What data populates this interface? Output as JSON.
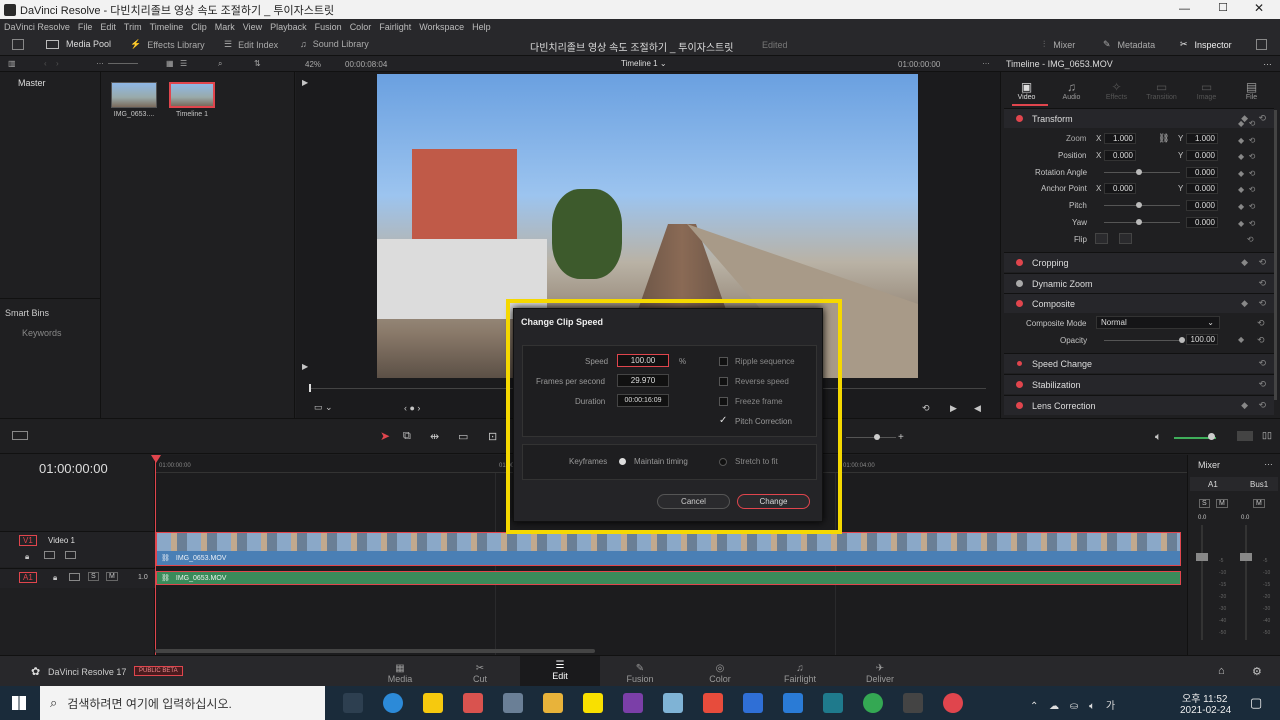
{
  "window": {
    "title": "DaVinci Resolve - 다빈치리졸브 영상 속도 조절하기 _ 투이자스트릿"
  },
  "menu": [
    "DaVinci Resolve",
    "File",
    "Edit",
    "Trim",
    "Timeline",
    "Clip",
    "Mark",
    "View",
    "Playback",
    "Fusion",
    "Color",
    "Fairlight",
    "Workspace",
    "Help"
  ],
  "toolbar": {
    "media_pool": "Media Pool",
    "effects_library": "Effects Library",
    "edit_index": "Edit Index",
    "sound_library": "Sound Library",
    "project_title": "다빈치리졸브 영상 속도 조절하기 _ 투이자스트릿",
    "edited": "Edited",
    "mixer": "Mixer",
    "metadata": "Metadata",
    "inspector": "Inspector"
  },
  "viewer": {
    "zoom": "42%",
    "timecode": "00:00:08:04",
    "timeline_name": "Timeline 1",
    "right_timecode": "01:00:00:00"
  },
  "media_pool": {
    "master": "Master",
    "smart_bins": "Smart Bins",
    "keywords": "Keywords",
    "clips": [
      {
        "name": "IMG_0653...."
      },
      {
        "name": "Timeline 1"
      }
    ]
  },
  "inspector": {
    "title": "Timeline - IMG_0653.MOV",
    "tabs": [
      "Video",
      "Audio",
      "Effects",
      "Transition",
      "Image",
      "File"
    ],
    "transform": "Transform",
    "zoom_label": "Zoom",
    "zoom_x": "1.000",
    "zoom_y": "1.000",
    "position_label": "Position",
    "pos_x": "0.000",
    "pos_y": "0.000",
    "rotation_label": "Rotation Angle",
    "rotation": "0.000",
    "anchor_label": "Anchor Point",
    "anchor_x": "0.000",
    "anchor_y": "0.000",
    "pitch_label": "Pitch",
    "pitch": "0.000",
    "yaw_label": "Yaw",
    "yaw": "0.000",
    "flip_label": "Flip",
    "cropping": "Cropping",
    "dynamic_zoom": "Dynamic Zoom",
    "composite": "Composite",
    "composite_mode_label": "Composite Mode",
    "composite_mode": "Normal",
    "opacity_label": "Opacity",
    "opacity": "100.00",
    "speed_change": "Speed Change",
    "stabilization": "Stabilization",
    "lens_correction": "Lens Correction",
    "x": "X",
    "y": "Y"
  },
  "dialog": {
    "title": "Change Clip Speed",
    "speed_label": "Speed",
    "speed": "100.00",
    "percent": "%",
    "fps_label": "Frames per second",
    "fps": "29.970",
    "duration_label": "Duration",
    "duration": "00:00:16:09",
    "ripple": "Ripple sequence",
    "reverse": "Reverse speed",
    "freeze": "Freeze frame",
    "pitch": "Pitch Correction",
    "keyframes_label": "Keyframes",
    "maintain": "Maintain timing",
    "stretch": "Stretch to fit",
    "cancel": "Cancel",
    "change": "Change"
  },
  "timeline": {
    "timecode": "01:00:00:00",
    "ruler_start": "01:00:00:00",
    "ruler_mid": "01:00",
    "ruler_end": "01:00:04:00",
    "v1": "V1",
    "video1": "Video 1",
    "a1": "A1",
    "a1_level": "1.0",
    "s": "S",
    "m": "M",
    "clip_video": "IMG_0653.MOV",
    "clip_audio": "IMG_0653.MOV"
  },
  "mixer_panel": {
    "title": "Mixer",
    "a1": "A1",
    "bus1": "Bus1",
    "db_a1": "0.0",
    "db_bus": "0.0",
    "s": "S",
    "m": "M",
    "scale": [
      "-5",
      "-10",
      "-15",
      "-20",
      "-30",
      "-40",
      "-50"
    ]
  },
  "footer": {
    "app": "DaVinci Resolve 17",
    "badge": "PUBLIC BETA",
    "pages": [
      "Media",
      "Cut",
      "Edit",
      "Fusion",
      "Color",
      "Fairlight",
      "Deliver"
    ]
  },
  "taskbar": {
    "search": "검색하려면 여기에 입력하십시오.",
    "time": "오후 11:52",
    "date": "2021-02-24"
  },
  "colors": {
    "accent_red": "#e0454d",
    "highlight_yellow": "#f5d800",
    "audio_green": "#3a8a5a",
    "video_blue": "#4a7fb5"
  }
}
